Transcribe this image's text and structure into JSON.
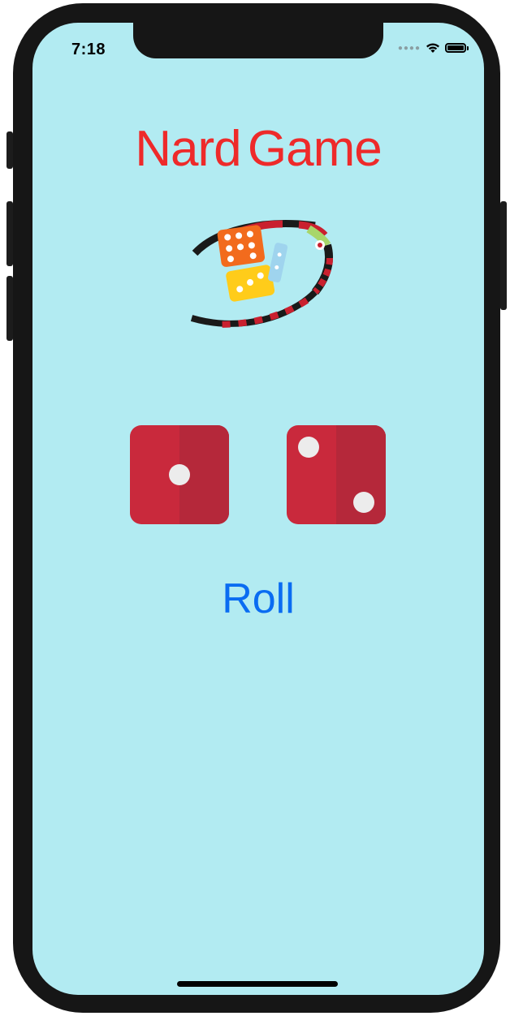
{
  "status_bar": {
    "time": "7:18",
    "signal_icon": "signal-dots-icon",
    "wifi_icon": "wifi-icon",
    "battery_icon": "battery-icon"
  },
  "title": {
    "text": "Nard Game",
    "color": "#ee2a2a"
  },
  "logo": {
    "icon": "dice-board-logo"
  },
  "dice": [
    {
      "value": 1,
      "color": "#c9293c"
    },
    {
      "value": 2,
      "color": "#c9293c"
    }
  ],
  "roll_button": {
    "label": "Roll",
    "color": "#0a6cf2"
  },
  "colors": {
    "background": "#b2ebf2",
    "device_frame": "#161616"
  }
}
